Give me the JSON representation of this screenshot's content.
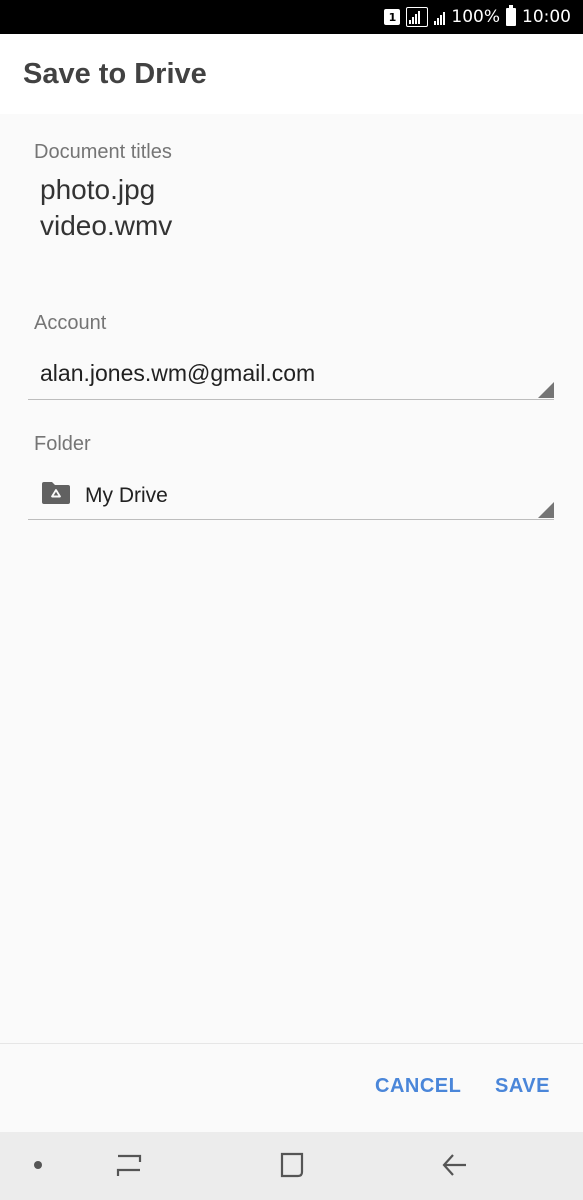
{
  "status_bar": {
    "sim_label": "1",
    "battery": "100%",
    "time": "10:00"
  },
  "app_bar": {
    "title": "Save to Drive"
  },
  "form": {
    "document_titles_label": "Document titles",
    "document_titles": [
      "photo.jpg",
      "video.wmv"
    ],
    "account_label": "Account",
    "account_value": "alan.jones.wm@gmail.com",
    "folder_label": "Folder",
    "folder_value": "My Drive"
  },
  "actions": {
    "cancel_label": "CANCEL",
    "save_label": "SAVE"
  },
  "colors": {
    "accent": "#4a86d9",
    "status_bar": "#000000",
    "background": "#fafafa"
  },
  "icons": [
    "sim-icon",
    "signal-icon",
    "battery-icon",
    "drive-folder-icon",
    "dropdown-arrow-icon",
    "recent-apps-icon",
    "home-icon",
    "back-icon"
  ]
}
